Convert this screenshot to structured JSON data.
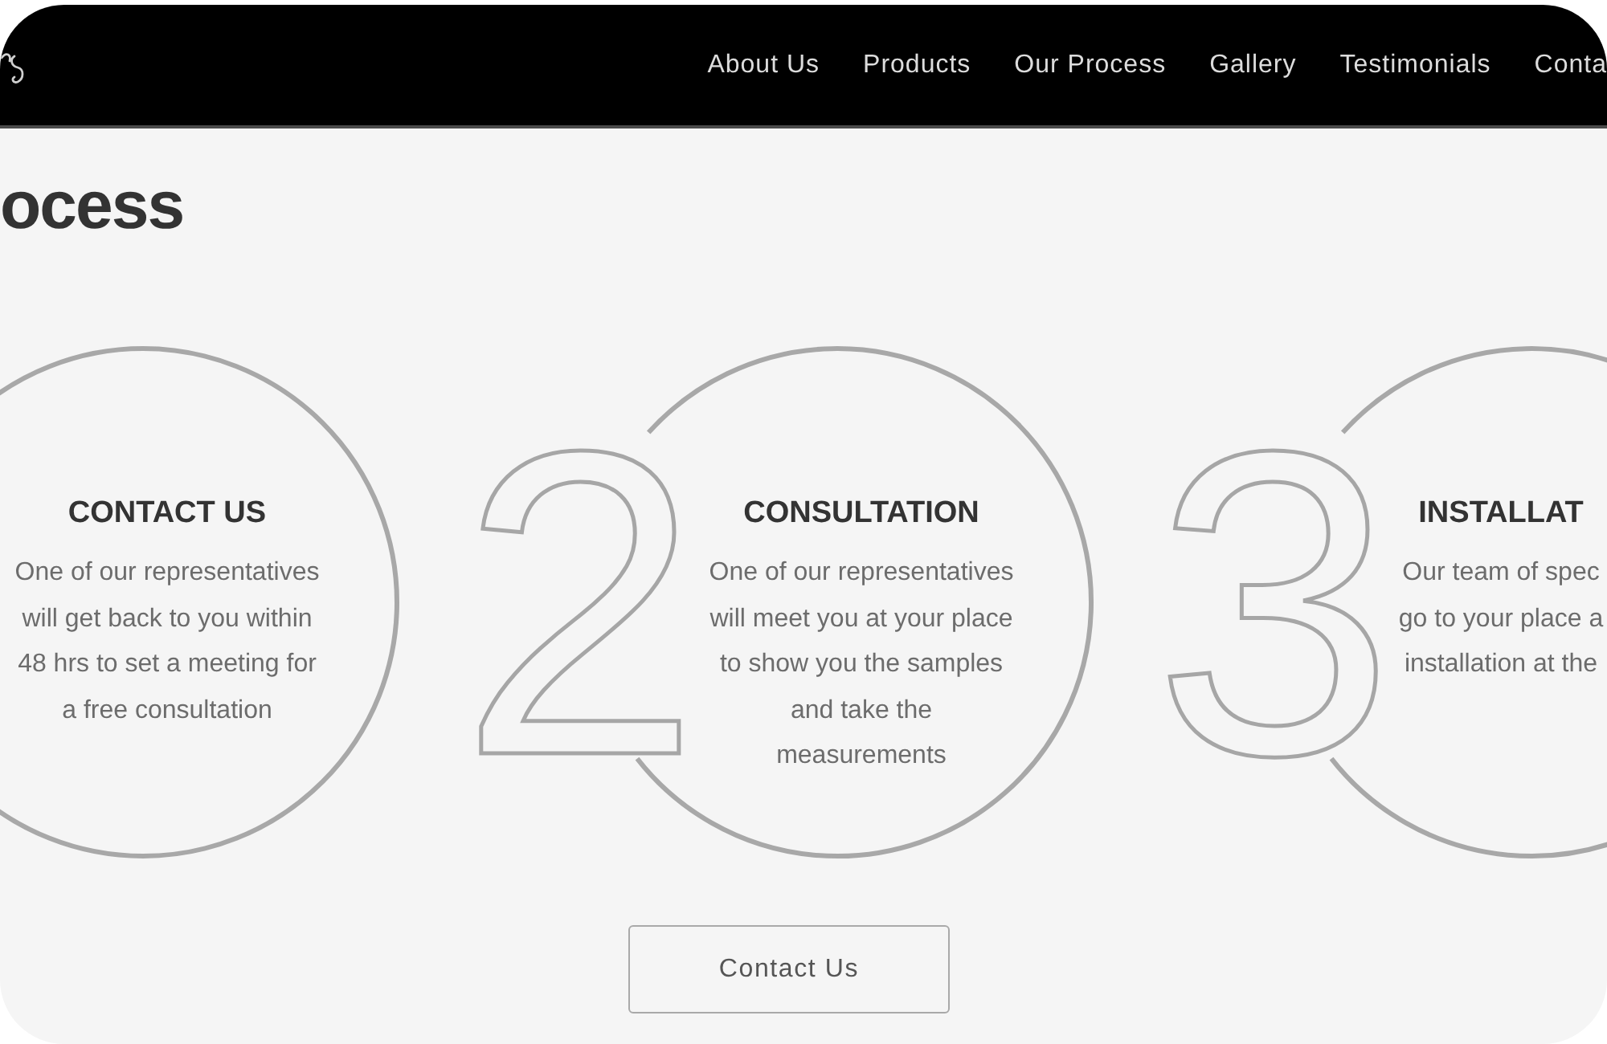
{
  "nav": {
    "items": [
      "About Us",
      "Products",
      "Our Process",
      "Gallery",
      "Testimonials",
      "Conta"
    ]
  },
  "heading": "ocess",
  "steps": [
    {
      "title": "CONTACT US",
      "lines": [
        "One of our representatives",
        "will get back to you within",
        "48 hrs to set a meeting for",
        "a free consultation"
      ]
    },
    {
      "number": "2",
      "title": "CONSULTATION",
      "lines": [
        "One of our representatives",
        "will meet you at your place",
        "to show you the samples",
        "and take the",
        "measurements"
      ]
    },
    {
      "number": "3",
      "title": "INSTALLAT",
      "lines": [
        "Our team of spec",
        "go to your place a",
        "installation at the"
      ]
    }
  ],
  "button": "Contact Us"
}
